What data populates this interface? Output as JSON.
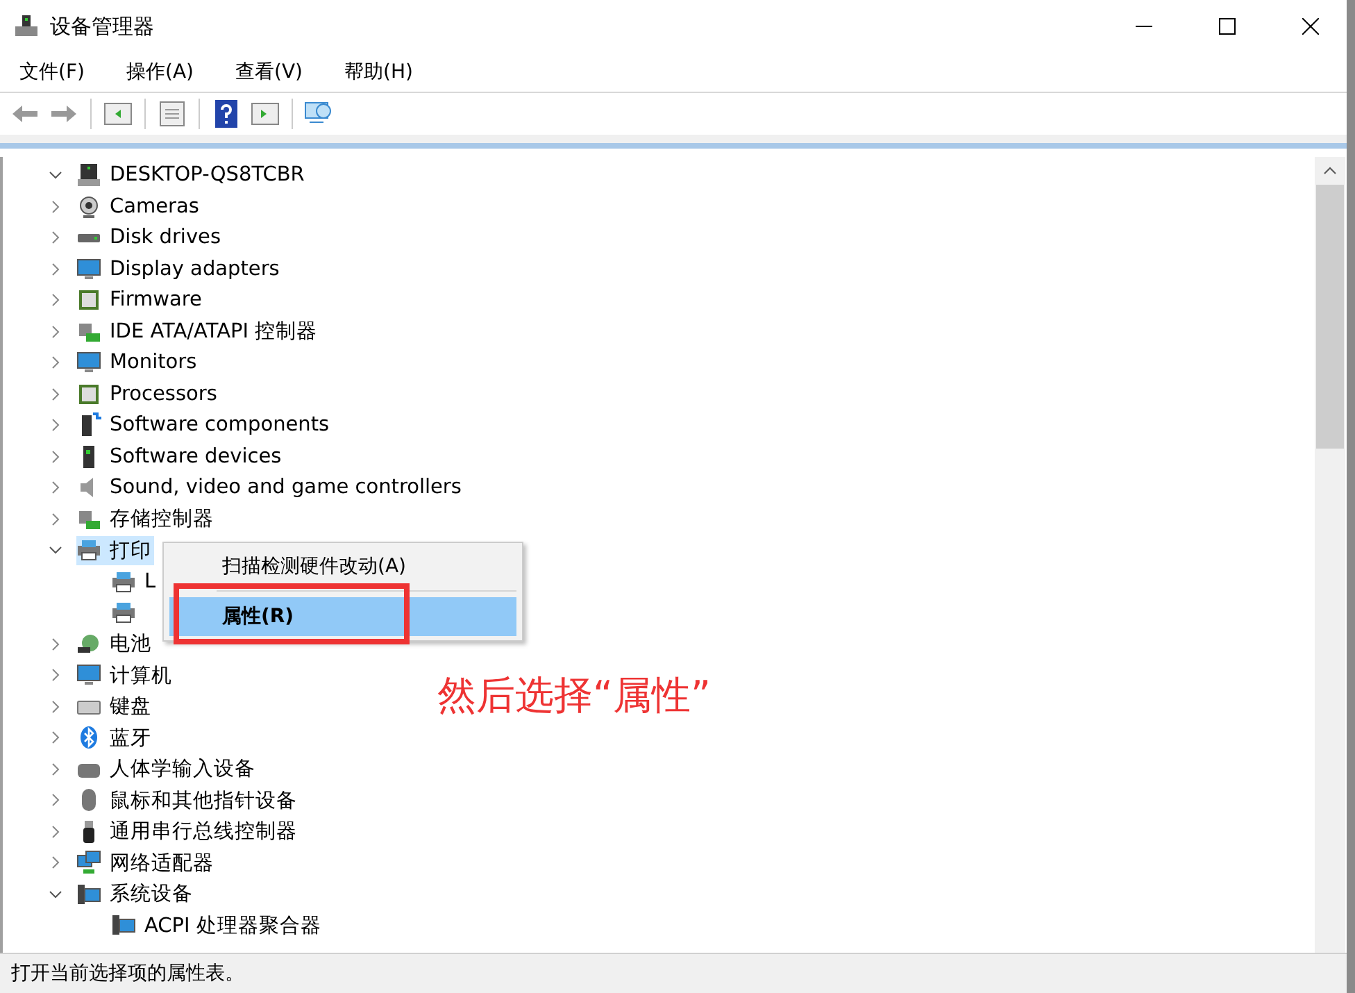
{
  "window": {
    "title": "设备管理器"
  },
  "menu": [
    "文件(F)",
    "操作(A)",
    "查看(V)",
    "帮助(H)"
  ],
  "tree": {
    "label": "DESKTOP-QS8TCBR",
    "expanded": true,
    "children": [
      {
        "label": "Cameras",
        "expanded": false
      },
      {
        "label": "Disk drives",
        "expanded": false
      },
      {
        "label": "Display adapters",
        "expanded": false
      },
      {
        "label": "Firmware",
        "expanded": false
      },
      {
        "label": "IDE ATA/ATAPI 控制器",
        "expanded": false
      },
      {
        "label": "Monitors",
        "expanded": false
      },
      {
        "label": "Processors",
        "expanded": false
      },
      {
        "label": "Software components",
        "expanded": false
      },
      {
        "label": "Software devices",
        "expanded": false
      },
      {
        "label": "Sound, video and game controllers",
        "expanded": false
      },
      {
        "label": "存储控制器",
        "expanded": false
      },
      {
        "label": "打印",
        "expanded": true,
        "selected": true,
        "children": [
          {
            "kind": "labelled",
            "label": "L"
          },
          {
            "kind": "icon-only"
          }
        ]
      },
      {
        "label": "电池",
        "expanded": false
      },
      {
        "label": "计算机",
        "expanded": false
      },
      {
        "label": "键盘",
        "expanded": false
      },
      {
        "label": "蓝牙",
        "expanded": false
      },
      {
        "label": "人体学输入设备",
        "expanded": false
      },
      {
        "label": "鼠标和其他指针设备",
        "expanded": false
      },
      {
        "label": "通用串行总线控制器",
        "expanded": false
      },
      {
        "label": "网络适配器",
        "expanded": false
      },
      {
        "label": "系统设备",
        "expanded": true,
        "children": [
          {
            "label": "ACPI 处理器聚合器"
          }
        ]
      }
    ]
  },
  "context_menu": [
    {
      "label": "扫描检测硬件改动(A)",
      "selected": false
    },
    {
      "label": "属性(R)",
      "selected": true
    }
  ],
  "annotation": "然后选择“属性”",
  "status_bar": "打开当前选择项的属性表。"
}
